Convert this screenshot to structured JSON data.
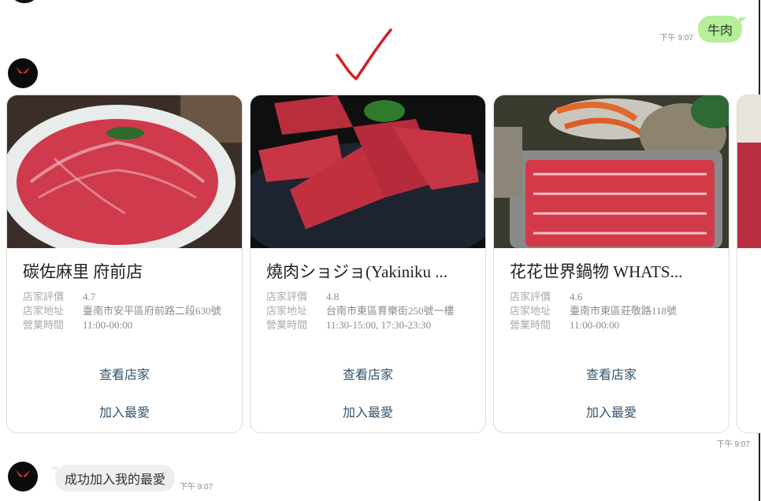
{
  "header": {
    "edge_present": true
  },
  "user_message": {
    "text": "牛肉",
    "time": "下午 9:07"
  },
  "cards": [
    {
      "title": "碳佐麻里 府前店",
      "rating_label": "店家評價",
      "rating": "4.7",
      "address_label": "店家地址",
      "address": "臺南市安平區府前路二段630號",
      "hours_label": "營業時間",
      "hours": "11:00-00:00",
      "view_label": "查看店家",
      "fav_label": "加入最愛"
    },
    {
      "title": "燒肉ショジョ(Yakiniku ...",
      "rating_label": "店家評價",
      "rating": "4.8",
      "address_label": "店家地址",
      "address": "台南市東區育樂街250號一樓",
      "hours_label": "營業時間",
      "hours": "11:30-15:00, 17:30-23:30",
      "view_label": "查看店家",
      "fav_label": "加入最愛"
    },
    {
      "title": "花花世界鍋物 WHATS...",
      "rating_label": "店家評價",
      "rating": "4.6",
      "address_label": "店家地址",
      "address": "臺南市東區莊敬路118號",
      "hours_label": "營業時間",
      "hours": "11:00-00:00",
      "view_label": "查看店家",
      "fav_label": "加入最愛"
    }
  ],
  "carousel_time": "下午 9:07",
  "bot_reply": {
    "text": "成功加入我的最愛",
    "time": "下午 9:07"
  },
  "colors": {
    "user_bubble": "#b6ee99",
    "bot_bubble": "#eeeeee",
    "action_text": "#36546e",
    "check": "#d42020"
  },
  "icons": {
    "avatar": "bot-logo-icon",
    "check": "checkmark-icon"
  }
}
